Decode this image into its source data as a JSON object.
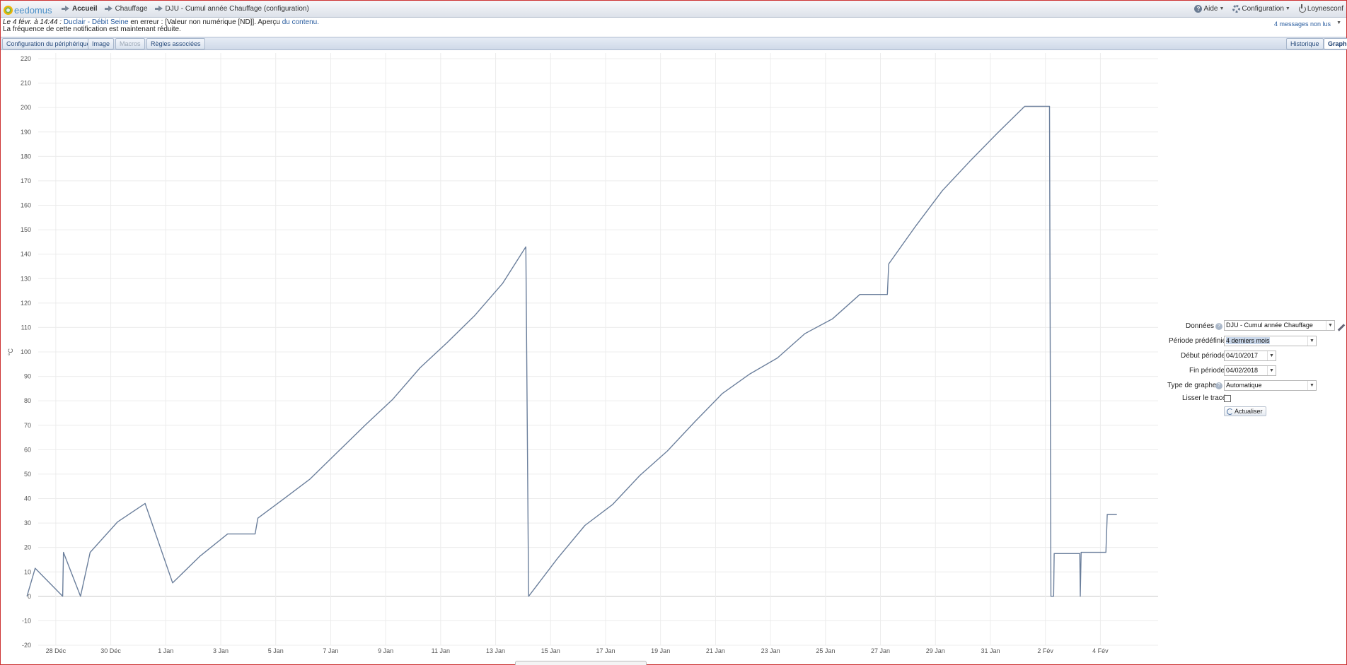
{
  "app": {
    "logo_text": "eedomus"
  },
  "breadcrumb": {
    "items": [
      "Accueil",
      "Chauffage",
      "DJU - Cumul année Chauffage (configuration)"
    ]
  },
  "topright": {
    "help": "Aide",
    "config": "Configuration",
    "user": "Loynesconf"
  },
  "notification": {
    "date": "Le 4 févr. à 14:44 :",
    "device": "Duclair - Débit Seine",
    "status": "en erreur",
    "detail": ": [Valeur non numérique [ND]]. Aperçu",
    "link": "du contenu.",
    "line2": "La fréquence de cette notification est maintenant réduite.",
    "unread": "4 messages non lus"
  },
  "tabs": {
    "left": [
      "Configuration du périphérique",
      "Image",
      "Macros",
      "Règles associées"
    ],
    "right": [
      "Historique",
      "Graphe"
    ]
  },
  "form": {
    "donnees_label": "Données",
    "donnees_value": "DJU - Cumul année Chauffage",
    "periode_label": "Période prédéfinie",
    "periode_value": "4 derniers mois",
    "debut_label": "Début période",
    "debut_value": "04/10/2017",
    "fin_label": "Fin période",
    "fin_value": "04/02/2018",
    "type_label": "Type de graphe",
    "type_value": "Automatique",
    "lisser_label": "Lisser le tracé",
    "lisser_checked": false,
    "refresh_label": "Actualiser"
  },
  "chart_data": {
    "type": "line",
    "ylabel": "°C",
    "ylim": [
      -20,
      220
    ],
    "yticks": [
      -20,
      -10,
      0,
      10,
      20,
      30,
      40,
      50,
      60,
      70,
      80,
      90,
      100,
      110,
      120,
      130,
      140,
      150,
      160,
      170,
      180,
      190,
      200,
      210,
      220
    ],
    "xlim": [
      0,
      41.1
    ],
    "xticks": [
      {
        "x": 1,
        "label": "28 Déc"
      },
      {
        "x": 3,
        "label": "30 Déc"
      },
      {
        "x": 5,
        "label": "1 Jan"
      },
      {
        "x": 7,
        "label": "3 Jan"
      },
      {
        "x": 9,
        "label": "5 Jan"
      },
      {
        "x": 11,
        "label": "7 Jan"
      },
      {
        "x": 13,
        "label": "9 Jan"
      },
      {
        "x": 15,
        "label": "11 Jan"
      },
      {
        "x": 17,
        "label": "13 Jan"
      },
      {
        "x": 19,
        "label": "15 Jan"
      },
      {
        "x": 21,
        "label": "17 Jan"
      },
      {
        "x": 23,
        "label": "19 Jan"
      },
      {
        "x": 25,
        "label": "21 Jan"
      },
      {
        "x": 27,
        "label": "23 Jan"
      },
      {
        "x": 29,
        "label": "25 Jan"
      },
      {
        "x": 31,
        "label": "27 Jan"
      },
      {
        "x": 33,
        "label": "29 Jan"
      },
      {
        "x": 35,
        "label": "31 Jan"
      },
      {
        "x": 37,
        "label": "2 Fév"
      },
      {
        "x": 39,
        "label": "4 Fév"
      }
    ],
    "series": [
      {
        "color": "#6b7f9c",
        "points": [
          [
            -0.05,
            0
          ],
          [
            0.25,
            11.5
          ],
          [
            1.25,
            0
          ],
          [
            1.28,
            18
          ],
          [
            1.9,
            0
          ],
          [
            2.25,
            18
          ],
          [
            3.25,
            30.5
          ],
          [
            4.25,
            38
          ],
          [
            5.25,
            5.5
          ],
          [
            6.25,
            16.5
          ],
          [
            7.25,
            25.5
          ],
          [
            8.25,
            25.5
          ],
          [
            8.35,
            32
          ],
          [
            9.25,
            39.5
          ],
          [
            10.25,
            48
          ],
          [
            11.25,
            59
          ],
          [
            12.25,
            70
          ],
          [
            13.25,
            80.5
          ],
          [
            14.25,
            93.5
          ],
          [
            15.25,
            104
          ],
          [
            16.25,
            115
          ],
          [
            17.25,
            128
          ],
          [
            18.1,
            143
          ],
          [
            18.2,
            0
          ],
          [
            19.25,
            15.5
          ],
          [
            20.25,
            29
          ],
          [
            21.25,
            37.5
          ],
          [
            22.25,
            49.5
          ],
          [
            23.25,
            59.5
          ],
          [
            24.25,
            71.5
          ],
          [
            25.25,
            83
          ],
          [
            26.25,
            91
          ],
          [
            27.25,
            97.5
          ],
          [
            28.25,
            107.5
          ],
          [
            29.25,
            113.5
          ],
          [
            30.25,
            123.5
          ],
          [
            31.25,
            123.5
          ],
          [
            31.3,
            136
          ],
          [
            32.25,
            151
          ],
          [
            33.25,
            166
          ],
          [
            34.25,
            178
          ],
          [
            35.25,
            189.5
          ],
          [
            36.25,
            200.5
          ],
          [
            37.15,
            200.5
          ],
          [
            37.2,
            0
          ],
          [
            37.3,
            0
          ],
          [
            37.32,
            17.5
          ],
          [
            38.25,
            17.5
          ],
          [
            38.27,
            0
          ],
          [
            38.3,
            18
          ],
          [
            39.2,
            18
          ],
          [
            39.25,
            33.5
          ],
          [
            39.6,
            33.5
          ]
        ]
      }
    ]
  }
}
